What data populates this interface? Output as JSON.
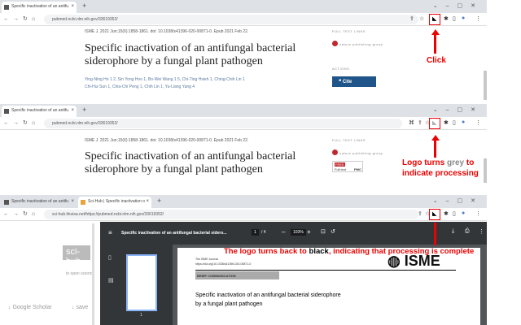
{
  "panels": [
    {
      "tabs": [
        "Specific inactivation of an antifu"
      ],
      "url": "pubmed.ncbi.nlm.nih.gov/33619352/",
      "annotation": "Click"
    },
    {
      "tabs": [
        "Specific inactivation of an antifu"
      ],
      "url": "pubmed.ncbi.nlm.nih.gov/33619352/",
      "annotation_parts": [
        "Logo turns ",
        "grey",
        " to indicate processing"
      ]
    },
    {
      "tabs": [
        "Specific inactivation of an antifu",
        "Sci-Hub | Specific inactivation o"
      ],
      "url": "sci-hub.hkvisa.net/https://pubmed.ncbi.nlm.nih.gov/33619352/",
      "annotation_parts": [
        "The logo turns back to ",
        "black",
        ", indicating that processing is complete"
      ]
    }
  ],
  "article": {
    "citation": "ISME J. 2021 Jun;15(6):1858-1861. doi: 10.1038/s41396-020-00871-0. Epub 2021 Feb 22.",
    "title": "Specific inactivation of an antifungal bacterial siderophore by a fungal plant pathogen",
    "authors_line1": "Ying-Ning Ho 1 2, Sin Yong Hoo 1, Bo-Wei Wang 1 5, Chi-Ting Hsieh 1, Ching-Chih Lin 1",
    "authors_line2": "Chi-Hui Sun 1, Chia-Chi Peng 1, Chih Lin 1, Yu-Liang Yang 4",
    "full_text_links": "FULL TEXT LINKS",
    "publisher": "nature publishing group",
    "actions": "ACTIONS",
    "cite": "Cite",
    "free": "FREE",
    "full_text": "Full text",
    "pmc": "PMC"
  },
  "scihub": {
    "logo": "sci-hub",
    "tagline": "to open science",
    "google_scholar": "↓ Google Scholar",
    "save": "↓ save"
  },
  "pdf": {
    "title": "Specific inactivation of an antifungal bacterial sidero...",
    "page": "1",
    "pages": "/ 4",
    "zoom": "103%",
    "thumb_label": "1",
    "journal": "The ISME Journal",
    "doi": "https://doi.org/10.1038/s41396-020-00871-0",
    "section": "BRIEF COMMUNICATION",
    "isme": "ISME",
    "title_line1": "Specific inactivation of an antifungal bacterial siderophore",
    "title_line2": "by a fungal plant pathogen"
  }
}
